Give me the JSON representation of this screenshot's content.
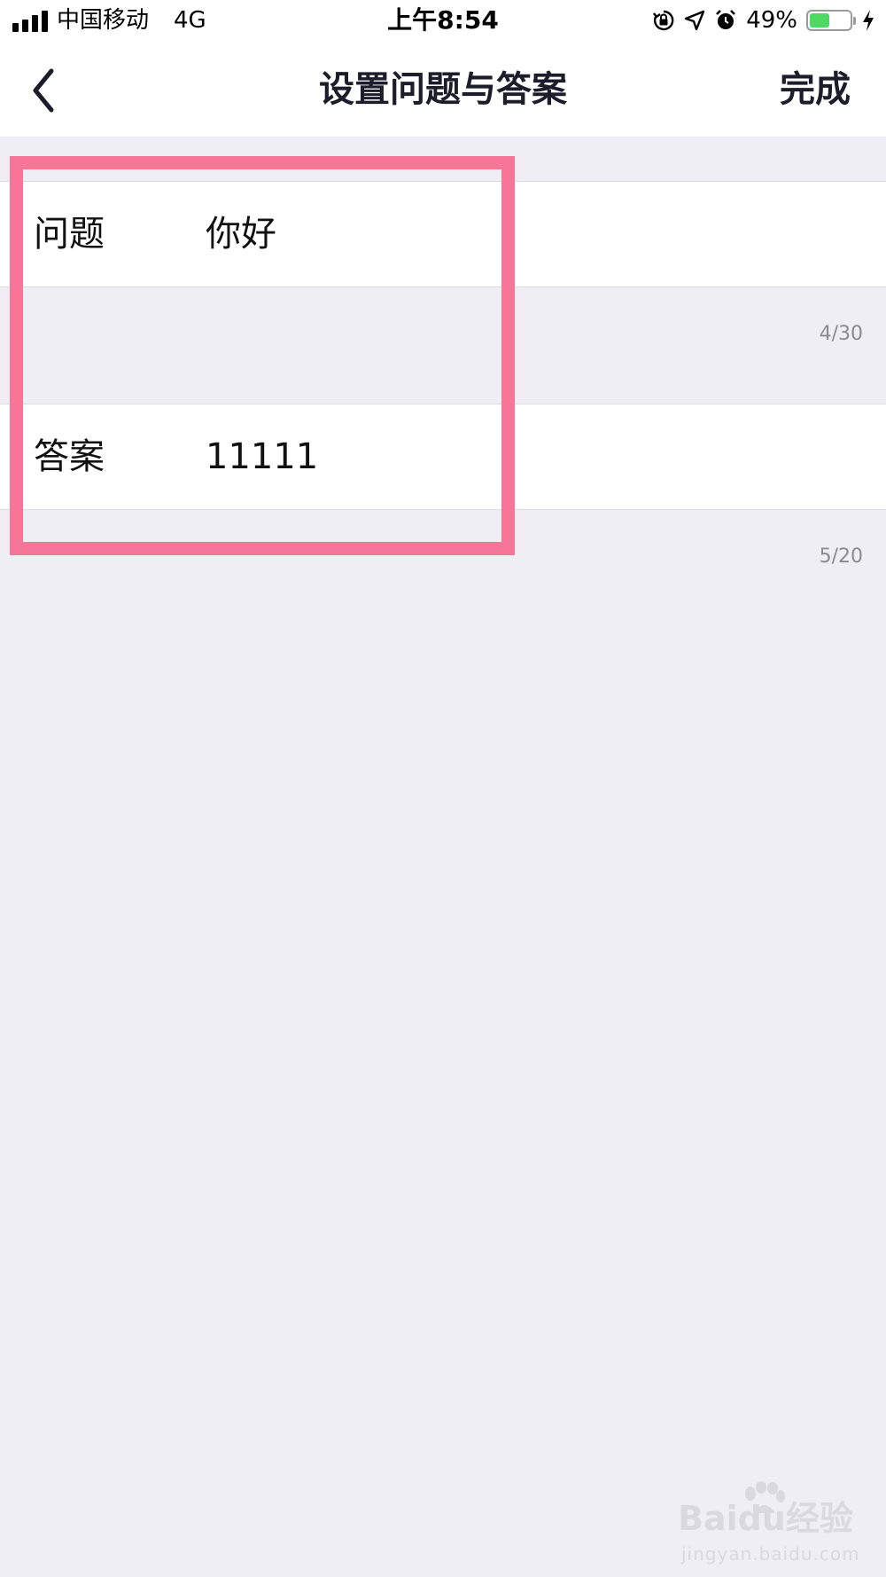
{
  "status_bar": {
    "carrier": "中国移动",
    "network": "4G",
    "time": "上午8:54",
    "battery_percent_label": "49%",
    "battery_level": 0.49,
    "icons": [
      "signal-icon",
      "rotation-lock-icon",
      "location-icon",
      "alarm-icon",
      "battery-icon",
      "charging-icon"
    ]
  },
  "nav": {
    "back_icon": "chevron-left-icon",
    "title": "设置问题与答案",
    "done_label": "完成"
  },
  "form": {
    "question": {
      "label": "问题",
      "value": "你好",
      "counter": "4/30"
    },
    "answer": {
      "label": "答案",
      "value": "11111",
      "counter": "5/20"
    }
  },
  "annotation": {
    "highlight_color": "#f77596"
  },
  "watermark": {
    "text": "Baidu经验",
    "subtext": "jingyan.baidu.com"
  }
}
